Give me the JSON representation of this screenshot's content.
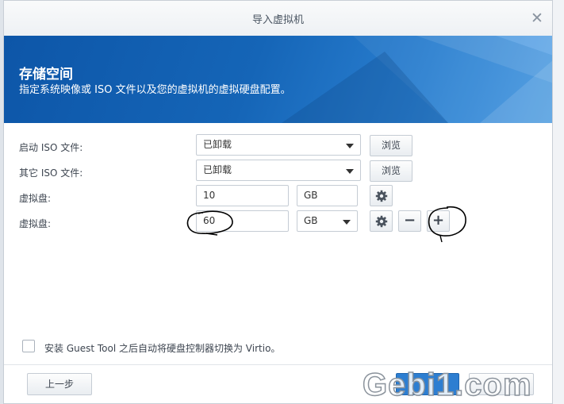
{
  "dialog": {
    "title": "导入虚拟机",
    "close_symbol": "✕"
  },
  "banner": {
    "title": "存储空间",
    "subtitle": "指定系统映像或 ISO 文件以及您的虚拟机的虚拟硬盘配置。"
  },
  "form": {
    "boot_iso": {
      "label": "启动 ISO 文件:",
      "value": "已卸载",
      "browse": "浏览"
    },
    "other_iso": {
      "label": "其它 ISO 文件:",
      "value": "已卸载",
      "browse": "浏览"
    },
    "disk1": {
      "label": "虚拟盘:",
      "size": "10",
      "unit": "GB"
    },
    "disk2": {
      "label": "虚拟盘:",
      "size": "60",
      "unit": "GB",
      "remove": "−",
      "add": "+"
    }
  },
  "guest_tool": {
    "label": "安装 Guest Tool 之后自动将硬盘控制器切换为 Virtio。",
    "checked": false
  },
  "footer": {
    "prev": "上一步"
  },
  "watermark": "Gebi1.com",
  "colors": {
    "banner": "#1565b7",
    "primary_button": "#2d7ed1"
  }
}
